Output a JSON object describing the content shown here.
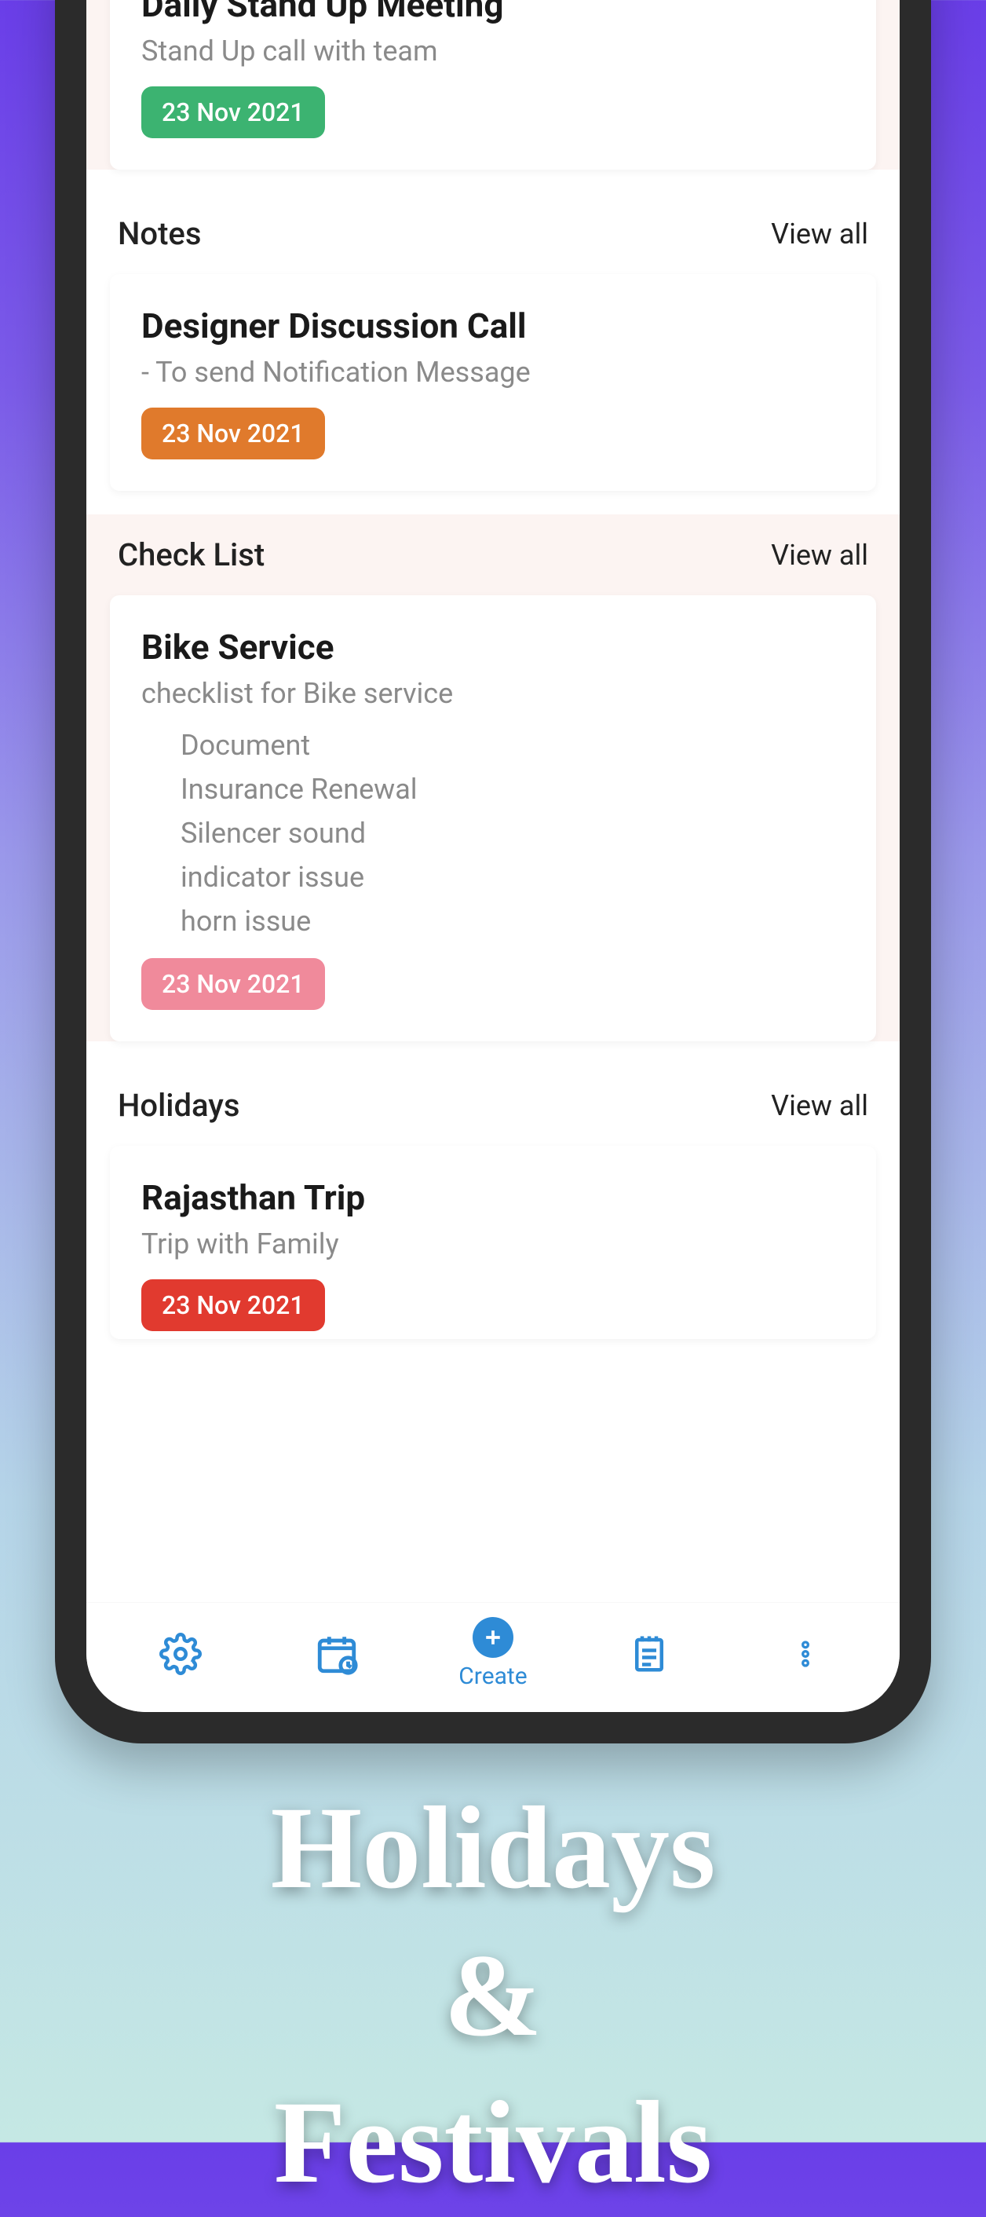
{
  "headline": {
    "line1": "Holidays",
    "line2": "&",
    "line3": "Festivals"
  },
  "common": {
    "view_all": "View all"
  },
  "nav": {
    "create_label": "Create"
  },
  "events": {
    "card": {
      "title": "Daily Stand Up Meeting",
      "subtitle": "Stand Up call with team",
      "date": "23 Nov 2021"
    }
  },
  "notes": {
    "section_title": "Notes",
    "card": {
      "title": "Designer Discussion Call",
      "subtitle": "- To send Notification Message",
      "date": "23 Nov 2021"
    }
  },
  "checklist": {
    "section_title": "Check List",
    "card": {
      "title": "Bike Service",
      "subtitle": "checklist for Bike service",
      "items": [
        "Document",
        "Insurance Renewal",
        "Silencer sound",
        "indicator issue",
        "horn issue"
      ],
      "date": "23 Nov 2021"
    }
  },
  "holidays": {
    "section_title": "Holidays",
    "card": {
      "title": "Rajasthan Trip",
      "subtitle": "Trip with Family",
      "date": "23 Nov 2021"
    }
  }
}
